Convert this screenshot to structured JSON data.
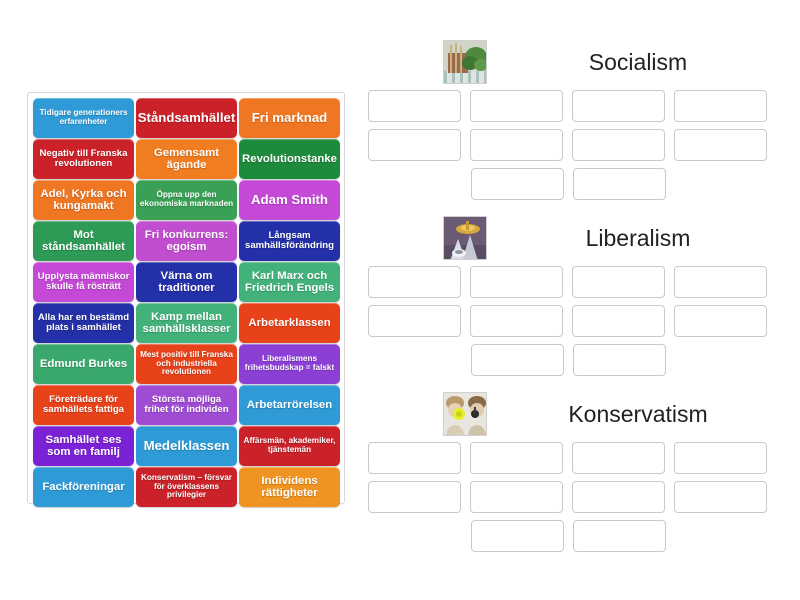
{
  "tray": {
    "name": "word-tile-tray",
    "tiles": [
      {
        "label": "Tidigare generationers erfarenheter",
        "color": "#2e9bd6",
        "size": "fs-xs"
      },
      {
        "label": "Ståndsamhället",
        "color": "#cb2229",
        "size": "fs-l"
      },
      {
        "label": "Fri marknad",
        "color": "#ef7622",
        "size": "fs-l"
      },
      {
        "label": "Negativ till Franska revolutionen",
        "color": "#cb2229",
        "size": "fs-s"
      },
      {
        "label": "Gemensamt ägande",
        "color": "#f07d20",
        "size": "fs-m"
      },
      {
        "label": "Revolutionstanke",
        "color": "#1e8a3c",
        "size": "fs-m"
      },
      {
        "label": "Adel, Kyrka och kungamakt",
        "color": "#ef7622",
        "size": "fs-m"
      },
      {
        "label": "Öppna upp den ekonomiska marknaden",
        "color": "#3aa055",
        "size": "fs-xs"
      },
      {
        "label": "Adam Smith",
        "color": "#c449d6",
        "size": "fs-l"
      },
      {
        "label": "Mot ståndsamhället",
        "color": "#2d9b56",
        "size": "fs-m"
      },
      {
        "label": "Fri konkurrens: egoism",
        "color": "#c14dcf",
        "size": "fs-m"
      },
      {
        "label": "Långsam samhällsförändring",
        "color": "#2430a8",
        "size": "fs-s"
      },
      {
        "label": "Upplysta människor skulle få rösträtt",
        "color": "#c449d6",
        "size": "fs-s"
      },
      {
        "label": "Värna om traditioner",
        "color": "#2430a8",
        "size": "fs-m"
      },
      {
        "label": "Karl Marx och Friedrich Engels",
        "color": "#43b27a",
        "size": "fs-m"
      },
      {
        "label": "Alla har en bestämd plats i samhället",
        "color": "#2430a8",
        "size": "fs-s"
      },
      {
        "label": "Kamp mellan samhällsklasser",
        "color": "#43b27a",
        "size": "fs-m"
      },
      {
        "label": "Arbetarklassen",
        "color": "#e8421a",
        "size": "fs-m"
      },
      {
        "label": "Edmund Burkes",
        "color": "#3aa86c",
        "size": "fs-m"
      },
      {
        "label": "Mest positiv till Franska och industriella revolutionen",
        "color": "#e8421a",
        "size": "fs-xs"
      },
      {
        "label": "Liberalismens frihetsbudskap = falskt",
        "color": "#8b3fd4",
        "size": "fs-xs"
      },
      {
        "label": "Företrädare för samhällets fattiga",
        "color": "#e8421a",
        "size": "fs-s"
      },
      {
        "label": "Största möjliga frihet för individen",
        "color": "#a04bd4",
        "size": "fs-s"
      },
      {
        "label": "Arbetarrörelsen",
        "color": "#2e9bd6",
        "size": "fs-m"
      },
      {
        "label": "Samhället ses som en familj",
        "color": "#7b21d6",
        "size": "fs-m"
      },
      {
        "label": "Medelklassen",
        "color": "#2e9bd6",
        "size": "fs-l"
      },
      {
        "label": "Affärsmän, akademiker, tjänstemän",
        "color": "#cb2229",
        "size": "fs-xs"
      },
      {
        "label": "Fackföreningar",
        "color": "#2e9bd6",
        "size": "fs-m"
      },
      {
        "label": "Konservatism – försvar för överklassens privilegier",
        "color": "#cb2229",
        "size": "fs-xs"
      },
      {
        "label": "Individens rättigheter",
        "color": "#ef9422",
        "size": "fs-m"
      }
    ]
  },
  "groups": [
    {
      "title": "Socialism",
      "thumb": "socialism-thumbnail",
      "slot_rows": [
        4,
        4,
        2
      ]
    },
    {
      "title": "Liberalism",
      "thumb": "liberalism-thumbnail",
      "slot_rows": [
        4,
        4,
        2
      ]
    },
    {
      "title": "Konservatism",
      "thumb": "konservatism-thumbnail",
      "slot_rows": [
        4,
        4,
        2
      ]
    }
  ],
  "colors": {
    "page_background": "#ffffff",
    "tray_border": "#d8d8d8",
    "slot_border": "#c9c9c9",
    "title_text": "#222222"
  }
}
